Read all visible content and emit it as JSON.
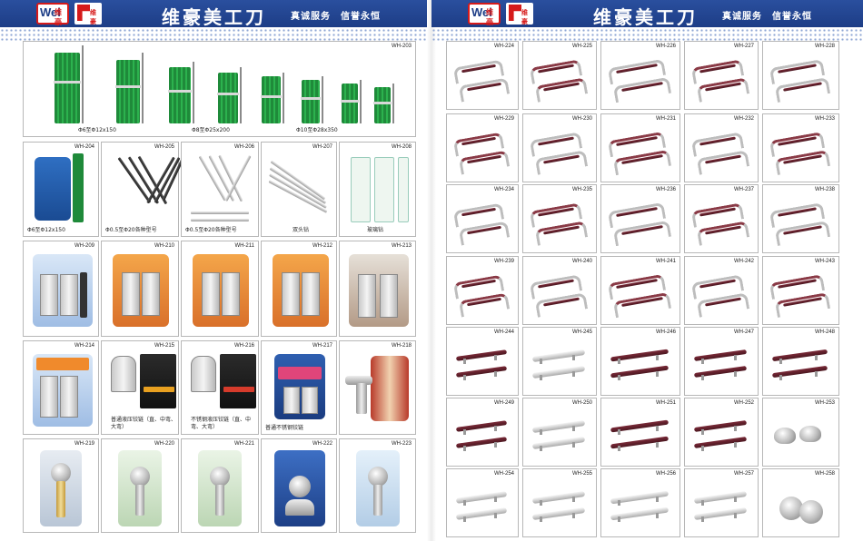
{
  "brand": {
    "title": "维豪美工刀",
    "slogan": "真诚服务　信誉永恒",
    "logo_text": "Wei",
    "logo_sub": "维豪"
  },
  "left_page": {
    "drills_top": {
      "code": "WH-203",
      "captions": [
        "Φ6至Φ12x150",
        "Φ8至Φ25x200",
        "Φ10至Φ28x350"
      ]
    },
    "row2": [
      {
        "code": "WH-204",
        "caption": "Φ6至Φ12x150"
      },
      {
        "code": "WH-205",
        "caption": "Φ0.5至Φ20各种型号"
      },
      {
        "code": "WH-206",
        "caption": "Φ0.5至Φ20各种型号"
      },
      {
        "code": "WH-207",
        "caption": "双头钻"
      },
      {
        "code": "WH-208",
        "caption": "玻璃钻"
      }
    ],
    "row3": [
      {
        "code": "WH-209"
      },
      {
        "code": "WH-210"
      },
      {
        "code": "WH-211"
      },
      {
        "code": "WH-212"
      },
      {
        "code": "WH-213"
      }
    ],
    "row4": [
      {
        "code": "WH-214",
        "caption": ""
      },
      {
        "code": "WH-215",
        "caption": "普通液压铰链（直、中弯、大弯）"
      },
      {
        "code": "WH-216",
        "caption": "不锈钢液压铰链（直、中弯、大弯）"
      },
      {
        "code": "WH-217",
        "caption": "普通不锈钢铰链"
      },
      {
        "code": "WH-218",
        "caption": ""
      }
    ],
    "row5": [
      {
        "code": "WH-219"
      },
      {
        "code": "WH-220"
      },
      {
        "code": "WH-221"
      },
      {
        "code": "WH-222"
      },
      {
        "code": "WH-223"
      }
    ]
  },
  "right_page": {
    "rows": [
      [
        "WH-224",
        "WH-225",
        "WH-226",
        "WH-227",
        "WH-228"
      ],
      [
        "WH-229",
        "WH-230",
        "WH-231",
        "WH-232",
        "WH-233"
      ],
      [
        "WH-234",
        "WH-235",
        "WH-236",
        "WH-237",
        "WH-238"
      ],
      [
        "WH-239",
        "WH-240",
        "WH-241",
        "WH-242",
        "WH-243"
      ],
      [
        "WH-244",
        "WH-245",
        "WH-246",
        "WH-247",
        "WH-248"
      ],
      [
        "WH-249",
        "WH-250",
        "WH-251",
        "WH-252",
        "WH-253"
      ],
      [
        "WH-254",
        "WH-255",
        "WH-256",
        "WH-257",
        "WH-258"
      ]
    ]
  }
}
